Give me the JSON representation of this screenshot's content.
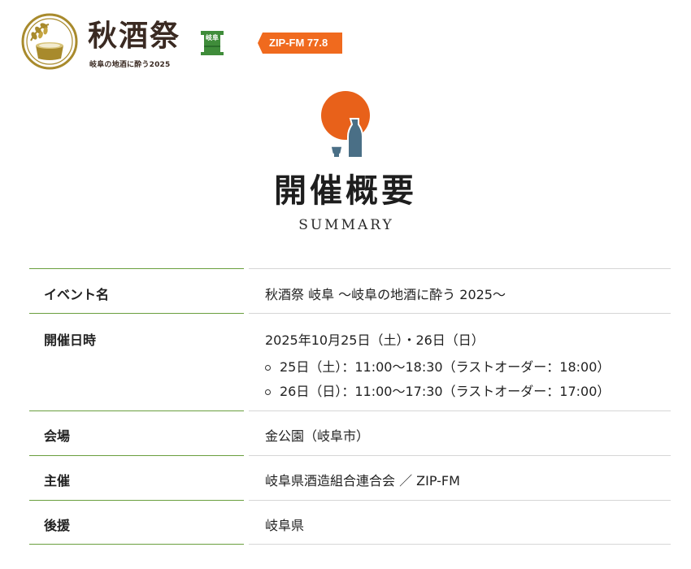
{
  "header": {
    "logo_title": "秋酒祭",
    "logo_badge": "岐阜",
    "logo_subtitle": "岐阜の地酒に酔う2025",
    "sponsor_label": "ZIP-FM 77.8"
  },
  "section": {
    "title": "開催概要",
    "subtitle": "SUMMARY"
  },
  "summary": {
    "rows": [
      {
        "label": "イベント名",
        "value": "秋酒祭 岐阜 〜岐阜の地酒に酔う 2025〜"
      },
      {
        "label": "開催日時",
        "value": "2025年10月25日（土）・26日（日）",
        "items": [
          "25日（土）：11:00〜18:30（ラストオーダー：18:00）",
          "26日（日）：11:00〜17:30（ラストオーダー：17:00）"
        ]
      },
      {
        "label": "会場",
        "value": "金公園（岐阜市）"
      },
      {
        "label": "主催",
        "value": "岐阜県酒造組合連合会 ／ ZIP-FM"
      },
      {
        "label": "後援",
        "value": "岐阜県"
      }
    ]
  },
  "colors": {
    "accent_green": "#6a9f3e",
    "sun_orange": "#e8611a",
    "bottle_blue": "#4a6f86",
    "sponsor_orange": "#f06a1e",
    "logo_gold": "#a88a2c"
  }
}
